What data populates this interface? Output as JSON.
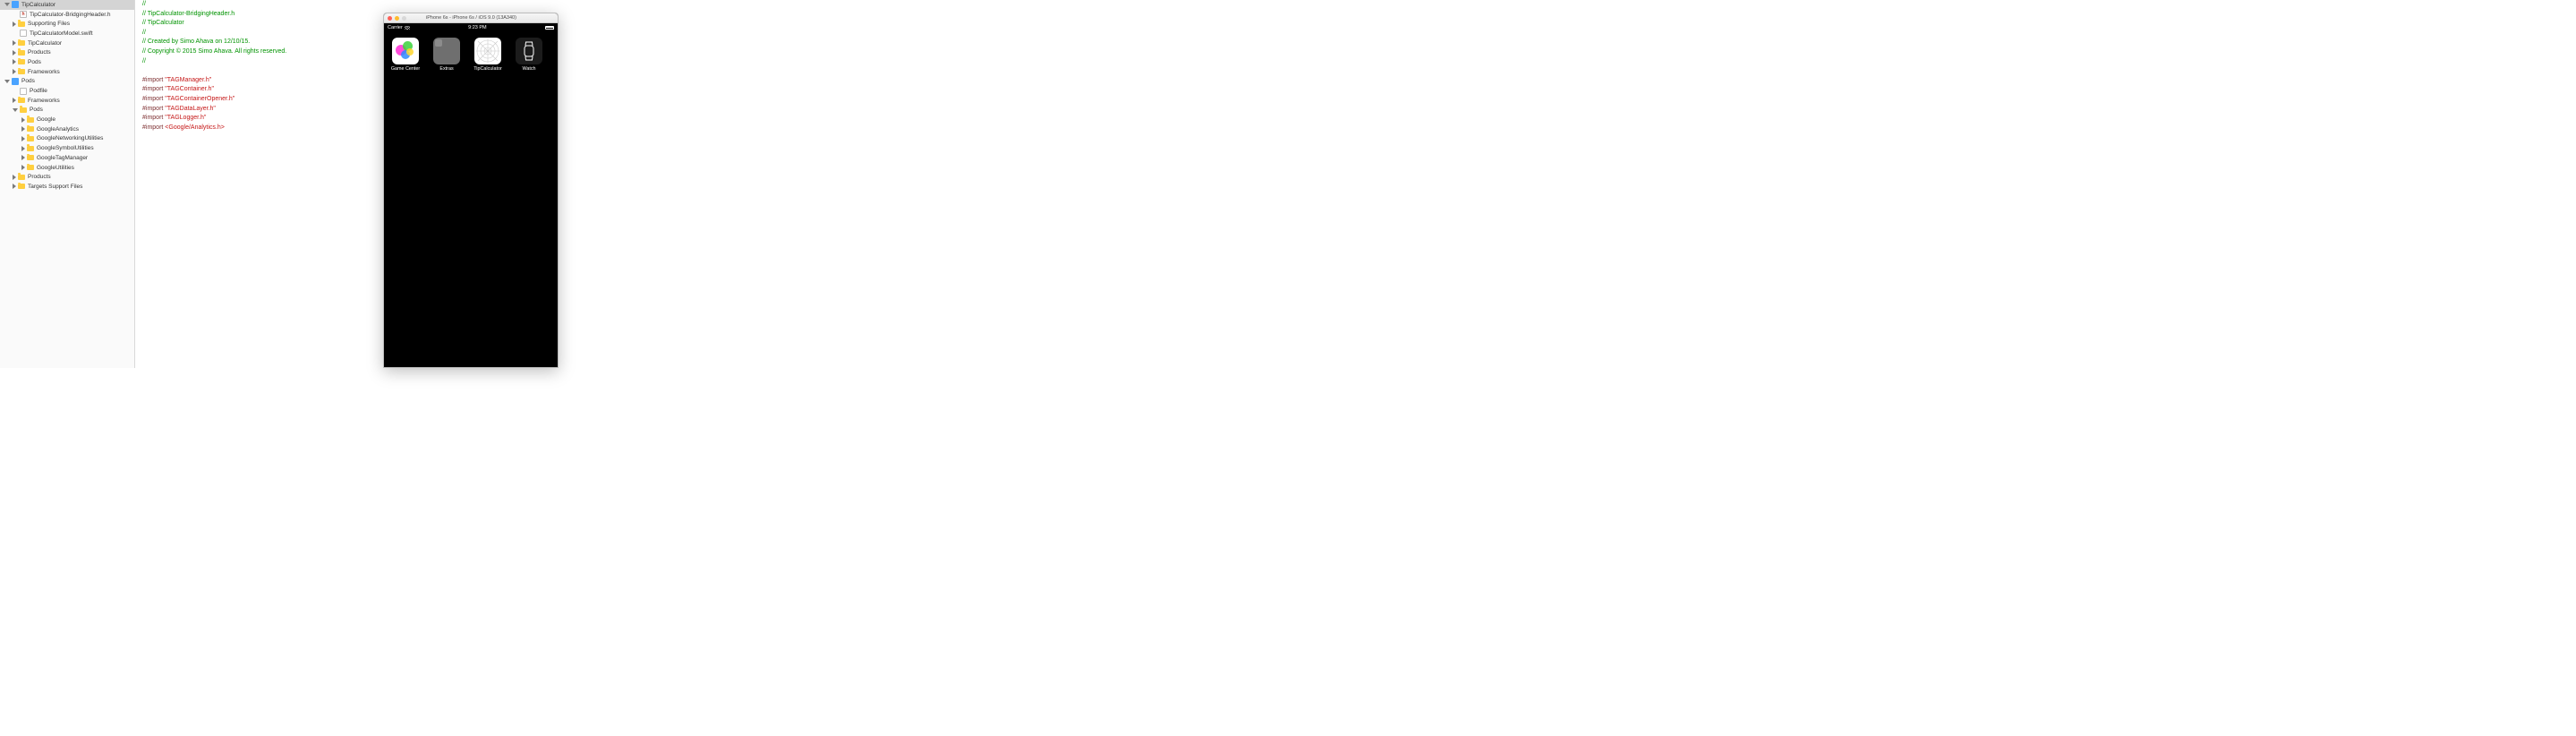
{
  "nav": {
    "root": "TipCalculator",
    "header_file": "TipCalculator-BridgingHeader.h",
    "supporting": "Supporting Files",
    "model_swift": "TipCalculatorModel.swift",
    "tipcalc_folder": "TipCalculator",
    "products": "Products",
    "pods_folder": "Pods",
    "frameworks": "Frameworks",
    "pods_project": "Pods",
    "podfile": "Podfile",
    "google": "Google",
    "google_analytics": "GoogleAnalytics",
    "google_net": "GoogleNetworkingUtilities",
    "google_sym": "GoogleSymbolUtilities",
    "google_tag": "GoogleTagManager",
    "google_util": "GoogleUtilities",
    "targets": "Targets Support Files"
  },
  "code": {
    "l1": "//",
    "l2_pre": "//  ",
    "l2": "TipCalculator-BridgingHeader.h",
    "l3": "TipCalculator",
    "l4": "//",
    "l5": "Created by Simo Ahava on 12/10/15.",
    "l6": "Copyright © 2015 Simo Ahava. All rights reserved.",
    "l7": "//",
    "imp": "#import ",
    "h1": "\"TAGManager.h\"",
    "h2": "\"TAGContainer.h\"",
    "h3": "\"TAGContainerOpener.h\"",
    "h4": "\"TAGDataLayer.h\"",
    "h5": "\"TAGLogger.h\"",
    "h6": "<Google/Analytics.h>"
  },
  "sim": {
    "title": "iPhone 6s - iPhone 6s / iOS 9.0 (13A340)",
    "carrier": "Carrier",
    "time": "9:23 PM",
    "apps": {
      "gc": "Game Center",
      "ex": "Extras",
      "tc": "TipCalculator",
      "wa": "Watch"
    }
  }
}
